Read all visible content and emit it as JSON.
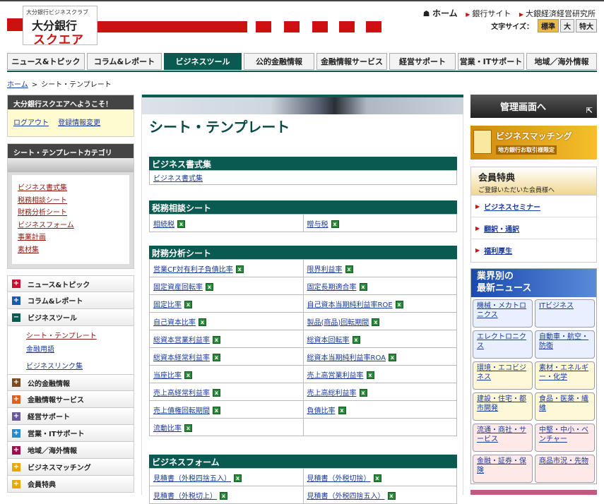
{
  "logo": {
    "small": "大分銀行ビジネスクラブ",
    "line1": "大分銀行",
    "line2": "スクエア"
  },
  "toplinks": {
    "home": "ホーム",
    "bank": "銀行サイト",
    "institute": "大銀経済経営研究所"
  },
  "fontsize": {
    "label": "文字サイズ：",
    "options": [
      "標準",
      "大",
      "特大"
    ],
    "selected": "標準"
  },
  "nav": {
    "tabs": [
      "ニュース&トピック",
      "コラム&レポート",
      "ビジネスツール",
      "公的金融情報",
      "金融情報サービス",
      "経営サポート",
      "営業・ITサポート",
      "地域／海外情報"
    ],
    "active": "ビジネスツール"
  },
  "breadcrumb": {
    "home": "ホーム",
    "sep": ">",
    "current": "シート・テンプレート"
  },
  "welcome": {
    "title": "大分銀行スクエアへようこそ！",
    "logout": "ログアウト",
    "change": "登録情報変更"
  },
  "category": {
    "title": "シート・テンプレートカテゴリ",
    "items": [
      "ビジネス書式集",
      "税務相談シート",
      "財務分析シート",
      "ビジネスフォーム",
      "事業計画",
      "素材集"
    ]
  },
  "sidenav": {
    "items": [
      {
        "label": "ニュース&トピック",
        "icon": "plus-icon",
        "color": "#c8102e"
      },
      {
        "label": "コラム&レポート",
        "icon": "plus-icon",
        "color": "#1a5aa8"
      },
      {
        "label": "ビジネスツール",
        "icon": "minus-icon",
        "color": "#0a5a52"
      },
      {
        "label": "公的金融情報",
        "icon": "plus-icon",
        "color": "#7a4a20"
      },
      {
        "label": "金融情報サービス",
        "icon": "plus-icon",
        "color": "#e06020"
      },
      {
        "label": "経営サポート",
        "icon": "plus-icon",
        "color": "#6a5a9a"
      },
      {
        "label": "営業・ITサポート",
        "icon": "plus-icon",
        "color": "#2a8ac8"
      },
      {
        "label": "地域／海外情報",
        "icon": "plus-icon",
        "color": "#a01050"
      },
      {
        "label": "ビジネスマッチング",
        "icon": "plus-icon",
        "color": "#e8a800"
      },
      {
        "label": "会員特典",
        "icon": "plus-icon",
        "color": "#e8a800"
      }
    ],
    "subitems": [
      "シート・テンプレート",
      "金融用語",
      "ビジネスリンク集"
    ]
  },
  "main": {
    "title": "シート・テンプレート",
    "sections": [
      {
        "title": "ビジネス書式集",
        "rows": [
          [
            "ビジネス書式集",
            ""
          ]
        ],
        "icons": false
      },
      {
        "title": "税務相談シート",
        "rows": [
          [
            "相続税",
            "贈与税"
          ]
        ],
        "icons": true
      },
      {
        "title": "財務分析シート",
        "rows": [
          [
            "営業CF対有利子負債比率",
            "限界利益率"
          ],
          [
            "固定資産回転率",
            "固定長期適合率"
          ],
          [
            "固定比率",
            "自己資本当期純利益率ROE"
          ],
          [
            "自己資本比率",
            "製品(商品)回転期間"
          ],
          [
            "総資本営業利益率",
            "総資本回転率"
          ],
          [
            "総資本経常利益率",
            "総資本当期純利益率ROA"
          ],
          [
            "当座比率",
            "売上高営業利益率"
          ],
          [
            "売上高経常利益率",
            "売上高総利益率"
          ],
          [
            "売上債権回転期間",
            "負債比率"
          ],
          [
            "流動比率",
            ""
          ]
        ],
        "icons": true
      },
      {
        "title": "ビジネスフォーム",
        "rows": [
          [
            "見積書（外税四捨五入）",
            "見積書（外税切捨）"
          ],
          [
            "見積書（外税切上）",
            "見積書（外税四捨五入）"
          ]
        ],
        "icons": true
      }
    ]
  },
  "right": {
    "admin": "管理画面へ",
    "matching": {
      "title": "ビジネスマッチング",
      "sub": "地方銀行お取引様限定"
    },
    "member": {
      "title": "会員特典",
      "sub": "ご登録いただいた会員様へ",
      "items": [
        "ビジネスセミナー",
        "翻訳・通訳",
        "福利厚生"
      ]
    },
    "news": {
      "title1": "業界別の",
      "title2": "最新ニュース",
      "items": [
        {
          "label": "機械・メカトロニクス",
          "tone": "blue"
        },
        {
          "label": "ITビジネス",
          "tone": "blue"
        },
        {
          "label": "エレクトロニクス",
          "tone": "blue"
        },
        {
          "label": "自動車・航空・防衛",
          "tone": "blue"
        },
        {
          "label": "環境・エコビジネス",
          "tone": "yellow"
        },
        {
          "label": "素材・エネルギー・化学",
          "tone": "yellow"
        },
        {
          "label": "建設・住宅・都市開発",
          "tone": "yellow"
        },
        {
          "label": "食品・医薬・繊維",
          "tone": "yellow"
        },
        {
          "label": "流通・商社・サービス",
          "tone": "pink"
        },
        {
          "label": "中堅・中小・ベンチャー",
          "tone": "pink"
        },
        {
          "label": "金融・証券・保険",
          "tone": "pink"
        },
        {
          "label": "商品市況・先物",
          "tone": "pink"
        }
      ]
    }
  }
}
